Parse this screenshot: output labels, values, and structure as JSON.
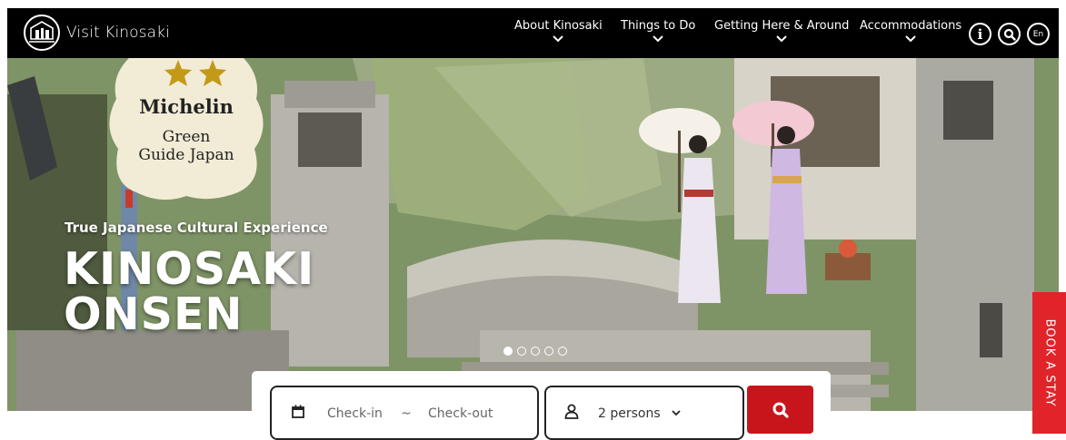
{
  "header": {
    "site_name": "Visit Kinosaki",
    "logo_icon": "kinosaki-logo-icon",
    "nav": [
      {
        "label": "About Kinosaki",
        "icon": "chevron-down-icon"
      },
      {
        "label": "Things to Do",
        "icon": "chevron-down-icon"
      },
      {
        "label": "Getting Here & Around",
        "icon": "chevron-down-icon"
      },
      {
        "label": "Accommodations",
        "icon": "chevron-down-icon"
      }
    ],
    "info_icon_glyph": "i",
    "lang_label": "En"
  },
  "hero": {
    "badge": {
      "stars": 2,
      "line1": "Michelin",
      "line2": "Green",
      "line3": "Guide Japan"
    },
    "tagline": "True Japanese Cultural Experience",
    "title_line1": "KINOSAKI",
    "title_line2": "ONSEN",
    "slides": {
      "count": 5,
      "active": 1
    }
  },
  "booking": {
    "checkin_placeholder": "Check-in",
    "separator": "~",
    "checkout_placeholder": "Check-out",
    "persons": "2 persons"
  },
  "side_tab": {
    "label": "BOOK A STAY"
  },
  "colors": {
    "nav_bg": "#000000",
    "accent_red": "#c8151b",
    "book_tab_red": "#e0242a",
    "badge_bg": "#f2ecd6",
    "star_gold": "#c39a18"
  }
}
